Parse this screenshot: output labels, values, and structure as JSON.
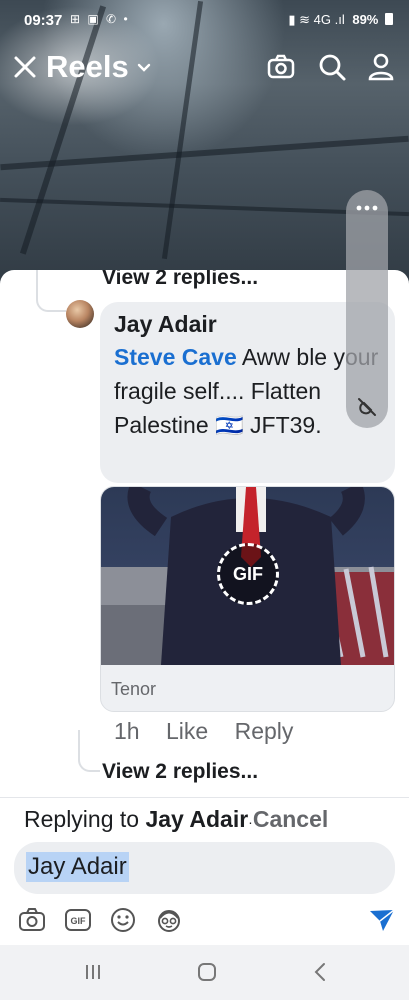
{
  "status_bar": {
    "time": "09:37",
    "left_icons": "⊞ ▣ ✆ •",
    "right_icons": "▮ ≋ 4G .ıl",
    "battery": "89%"
  },
  "top_bar": {
    "title": "Reels",
    "icons": [
      "close-icon",
      "chevron-down-icon",
      "camera-icon",
      "search-icon",
      "profile-icon"
    ]
  },
  "comments": {
    "previous_replies_link": "View 2 replies...",
    "comment": {
      "author": "Jay Adair",
      "mention": "Steve Cave",
      "text_first": "Aww ble",
      "text_rest": "your fragile self.... Flatten Palestine 🇮🇱 JFT39.",
      "gif_badge": "GIF",
      "gif_source": "Tenor",
      "time": "1h",
      "like_label": "Like",
      "reply_label": "Reply"
    },
    "next_replies_link": "View 2 replies..."
  },
  "floating_controls": {
    "icons": [
      "more-dots-icon",
      "mute-icon"
    ]
  },
  "reply_bar": {
    "replying_prefix": "Replying to",
    "replying_name": "Jay Adair",
    "separator": "·",
    "cancel_label": "Cancel",
    "input_value": "Jay Adair",
    "toolbar_icons": [
      "camera-icon",
      "gif-icon",
      "emoji-icon",
      "avatar-sticker-icon",
      "send-icon"
    ]
  },
  "nav_bar": {
    "icons": [
      "recents-icon",
      "home-icon",
      "back-icon"
    ]
  },
  "colors": {
    "accent_blue": "#1a6fd1",
    "bubble_bg": "#eceef1",
    "muted_text": "#65676b"
  }
}
